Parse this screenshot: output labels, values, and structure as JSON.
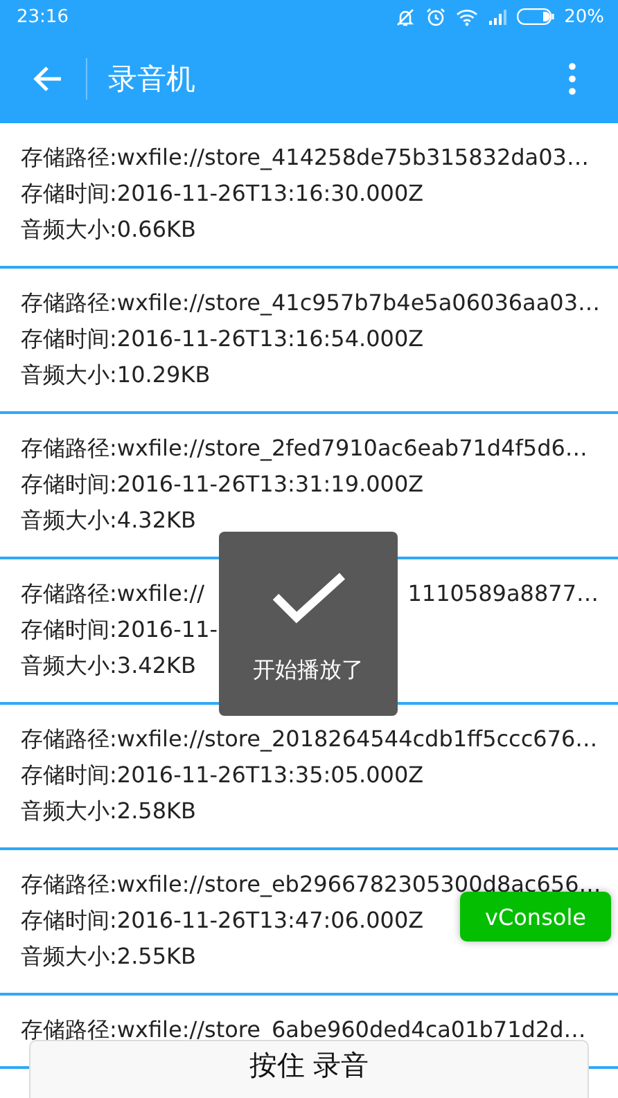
{
  "status_bar": {
    "time": "23:16",
    "battery": "20%"
  },
  "header": {
    "title": "录音机"
  },
  "records": [
    {
      "path": "存储路径:wxfile://store_414258de75b315832da03…",
      "time": "存储时间:2016-11-26T13:16:30.000Z",
      "size": "音频大小:0.66KB"
    },
    {
      "path": "存储路径:wxfile://store_41c957b7b4e5a06036aa03…",
      "time": "存储时间:2016-11-26T13:16:54.000Z",
      "size": "音频大小:10.29KB"
    },
    {
      "path": "存储路径:wxfile://store_2fed7910ac6eab71d4f5d6…",
      "time": "存储时间:2016-11-26T13:31:19.000Z",
      "size": "音频大小:4.32KB"
    },
    {
      "path": [
        "存储路径:wxfile://",
        "1110589a8877…"
      ],
      "time": [
        "存储时间:2016-11-"
      ],
      "size": "音频大小:3.42KB"
    },
    {
      "path": "存储路径:wxfile://store_2018264544cdb1ff5ccc676…",
      "time": "存储时间:2016-11-26T13:35:05.000Z",
      "size": "音频大小:2.58KB"
    },
    {
      "path": "存储路径:wxfile://store_eb2966782305300d8ac656…",
      "time": "存储时间:2016-11-26T13:47:06.000Z",
      "size": "音频大小:2.55KB"
    },
    {
      "path": "存储路径:wxfile://store_6abe960ded4ca01b71d2d…"
    }
  ],
  "toast": {
    "text": "开始播放了"
  },
  "vconsole_button": {
    "label": "vConsole"
  },
  "record_button": {
    "label": "按住 录音"
  }
}
